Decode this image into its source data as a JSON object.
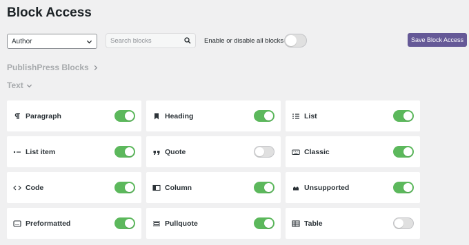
{
  "page": {
    "title": "Block Access"
  },
  "toolbar": {
    "role_value": "Author",
    "search_placeholder": "Search blocks",
    "toggle_all_label": "Enable or disable all blocks",
    "toggle_all_on": false,
    "save_label": "Save Block Access"
  },
  "sections": {
    "plugin_section": "PublishPress Blocks",
    "category": "Text"
  },
  "colors": {
    "accent": "#655997",
    "toggle_on": "#5cb85c",
    "toggle_off": "#e0e0e0"
  },
  "blocks": [
    {
      "label": "Paragraph",
      "icon": "paragraph-icon",
      "enabled": true
    },
    {
      "label": "Heading",
      "icon": "bookmark-icon",
      "enabled": true
    },
    {
      "label": "List",
      "icon": "list-icon",
      "enabled": true
    },
    {
      "label": "List item",
      "icon": "list-item-icon",
      "enabled": true
    },
    {
      "label": "Quote",
      "icon": "quote-icon",
      "enabled": false
    },
    {
      "label": "Classic",
      "icon": "keyboard-icon",
      "enabled": true
    },
    {
      "label": "Code",
      "icon": "code-icon",
      "enabled": true
    },
    {
      "label": "Column",
      "icon": "column-icon",
      "enabled": true
    },
    {
      "label": "Unsupported",
      "icon": "warning-icon",
      "enabled": true
    },
    {
      "label": "Preformatted",
      "icon": "preformatted-icon",
      "enabled": true
    },
    {
      "label": "Pullquote",
      "icon": "pullquote-icon",
      "enabled": true
    },
    {
      "label": "Table",
      "icon": "table-icon",
      "enabled": false
    }
  ]
}
